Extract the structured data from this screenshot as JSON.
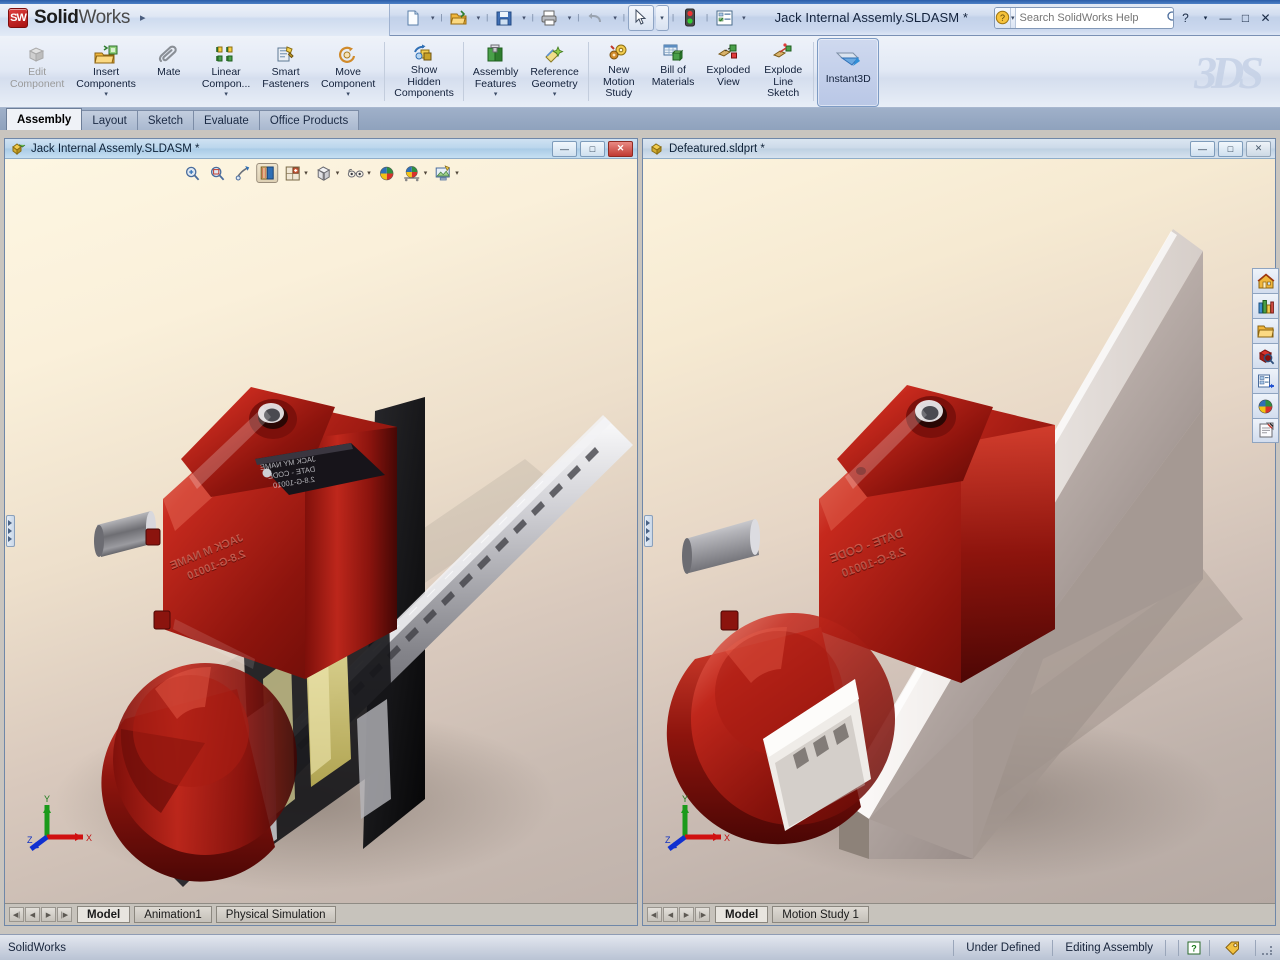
{
  "app": {
    "brand_bold": "Solid",
    "brand_light": "Works",
    "badge": "SW",
    "document_title": "Jack Internal Assemly.SLDASM *",
    "menu_arrow": "▸",
    "accent_blue": "#2a5ca8",
    "accent_red": "#a81111"
  },
  "quick_access": [
    {
      "name": "new-document",
      "label": "New",
      "caret": true
    },
    {
      "name": "open-document",
      "label": "Open",
      "caret": true
    },
    {
      "name": "save-document",
      "label": "Save",
      "caret": true
    },
    {
      "name": "print-document",
      "label": "Print",
      "caret": true
    },
    {
      "name": "undo",
      "label": "Undo",
      "caret": true
    },
    {
      "name": "select",
      "label": "Select",
      "caret": true,
      "framed": true
    },
    {
      "name": "rebuild",
      "label": "Rebuild",
      "caret": false
    },
    {
      "name": "options",
      "label": "Options",
      "caret": true
    }
  ],
  "help": {
    "search_value": "",
    "search_placeholder": "Search SolidWorks Help",
    "help_icon": "?",
    "magnifier_icon": "search-icon"
  },
  "window_buttons": {
    "help": "?",
    "help_caret": "▾",
    "minimize": "—",
    "restore": "□",
    "close": "✕"
  },
  "ribbon": {
    "commands": [
      {
        "label_lines": [
          "Edit",
          "Component"
        ],
        "icon": "edit-component-icon",
        "caret": false,
        "disabled": true,
        "active": false
      },
      {
        "label_lines": [
          "Insert",
          "Components"
        ],
        "icon": "insert-components-icon",
        "caret": true,
        "disabled": false,
        "active": false
      },
      {
        "label_lines": [
          "Mate"
        ],
        "icon": "mate-icon",
        "caret": false,
        "disabled": false,
        "active": false
      },
      {
        "label_lines": [
          "Linear",
          "Compon..."
        ],
        "icon": "linear-component-pattern-icon",
        "caret": true,
        "disabled": false,
        "active": false
      },
      {
        "label_lines": [
          "Smart",
          "Fasteners"
        ],
        "icon": "smart-fasteners-icon",
        "caret": false,
        "disabled": false,
        "active": false
      },
      {
        "label_lines": [
          "Move",
          "Component"
        ],
        "icon": "move-component-icon",
        "caret": true,
        "disabled": false,
        "active": false
      },
      {
        "label_lines": [
          "Show",
          "Hidden",
          "Components"
        ],
        "icon": "show-hidden-components-icon",
        "caret": false,
        "disabled": false,
        "active": false
      },
      {
        "label_lines": [
          "Assembly",
          "Features"
        ],
        "icon": "assembly-features-icon",
        "caret": true,
        "disabled": false,
        "active": false
      },
      {
        "label_lines": [
          "Reference",
          "Geometry"
        ],
        "icon": "reference-geometry-icon",
        "caret": true,
        "disabled": false,
        "active": false
      },
      {
        "label_lines": [
          "New",
          "Motion",
          "Study"
        ],
        "icon": "new-motion-study-icon",
        "caret": false,
        "disabled": false,
        "active": false
      },
      {
        "label_lines": [
          "Bill of",
          "Materials"
        ],
        "icon": "bill-of-materials-icon",
        "caret": false,
        "disabled": false,
        "active": false
      },
      {
        "label_lines": [
          "Exploded",
          "View"
        ],
        "icon": "exploded-view-icon",
        "caret": false,
        "disabled": false,
        "active": false
      },
      {
        "label_lines": [
          "Explode",
          "Line",
          "Sketch"
        ],
        "icon": "explode-line-sketch-icon",
        "caret": false,
        "disabled": false,
        "active": false
      },
      {
        "label_lines": [
          "Instant3D"
        ],
        "icon": "instant3d-icon",
        "caret": false,
        "disabled": false,
        "active": true
      }
    ],
    "watermark": "3DS"
  },
  "ribbon_tabs": [
    {
      "label": "Assembly",
      "selected": true
    },
    {
      "label": "Layout",
      "selected": false
    },
    {
      "label": "Sketch",
      "selected": false
    },
    {
      "label": "Evaluate",
      "selected": false
    },
    {
      "label": "Office Products",
      "selected": false
    }
  ],
  "windows": [
    {
      "name": "assembly-window",
      "title": "Jack Internal Assemly.SLDASM *",
      "icon": "assembly-document-icon",
      "active": true,
      "buttons": {
        "minimize": "—",
        "maximize": "□",
        "close": "✕"
      },
      "sheet_tabs": [
        {
          "label": "Model",
          "selected": true
        },
        {
          "label": "Animation1",
          "selected": false
        },
        {
          "label": "Physical Simulation",
          "selected": false
        }
      ],
      "hud_buttons": [
        {
          "name": "zoom-to-fit-icon",
          "caret": false,
          "on": false
        },
        {
          "name": "zoom-to-area-icon",
          "caret": false,
          "on": false
        },
        {
          "name": "previous-view-icon",
          "caret": false,
          "on": false
        },
        {
          "name": "section-view-icon",
          "caret": false,
          "on": true
        },
        {
          "name": "view-orientation-icon",
          "caret": true,
          "on": false
        },
        {
          "name": "display-style-icon",
          "caret": true,
          "on": false
        },
        {
          "name": "hide-show-items-icon",
          "caret": true,
          "on": false
        },
        {
          "name": "edit-appearance-icon",
          "caret": false,
          "on": false
        },
        {
          "name": "apply-scene-icon",
          "caret": true,
          "on": false
        },
        {
          "name": "view-settings-icon",
          "caret": true,
          "on": false
        }
      ],
      "triad": {
        "x": "X",
        "y": "Y",
        "z": "Z"
      }
    },
    {
      "name": "part-window",
      "title": "Defeatured.sldprt *",
      "icon": "part-document-icon",
      "active": false,
      "buttons": {
        "minimize": "—",
        "maximize": "□",
        "close": "✕"
      },
      "sheet_tabs": [
        {
          "label": "Model",
          "selected": true
        },
        {
          "label": "Motion Study 1",
          "selected": false
        }
      ],
      "hud_buttons": [],
      "triad": {
        "x": "X",
        "y": "Y",
        "z": "Z"
      }
    }
  ],
  "task_pane": [
    {
      "name": "solidworks-resources-icon",
      "label": "SolidWorks Resources"
    },
    {
      "name": "design-library-icon",
      "label": "Design Library"
    },
    {
      "name": "file-explorer-icon",
      "label": "File Explorer"
    },
    {
      "name": "search-icon",
      "label": "Search"
    },
    {
      "name": "view-palette-icon",
      "label": "View Palette"
    },
    {
      "name": "appearances-scenes-icon",
      "label": "Appearances, Scenes and Decals"
    },
    {
      "name": "custom-properties-icon",
      "label": "Custom Properties"
    }
  ],
  "status_bar": {
    "message": "SolidWorks",
    "sketch_status": "Under Defined",
    "edit_mode": "Editing Assembly",
    "help_icon": "?",
    "tag_icon": "tag-icon"
  },
  "model_art": {
    "part_label_text": "JACK MY NAME\nDATE - CODE\n2.8-G-10010",
    "colors": {
      "red_body": "#b01a14",
      "red_dark": "#6f0d0a",
      "red_light": "#e85a4a",
      "steel": "#8c8c90",
      "steel_light": "#d8d8dc",
      "plate": "#9b8e8a",
      "plate_light": "#ded6d2",
      "label_black": "#17141a",
      "brass": "#d8d08a"
    }
  }
}
